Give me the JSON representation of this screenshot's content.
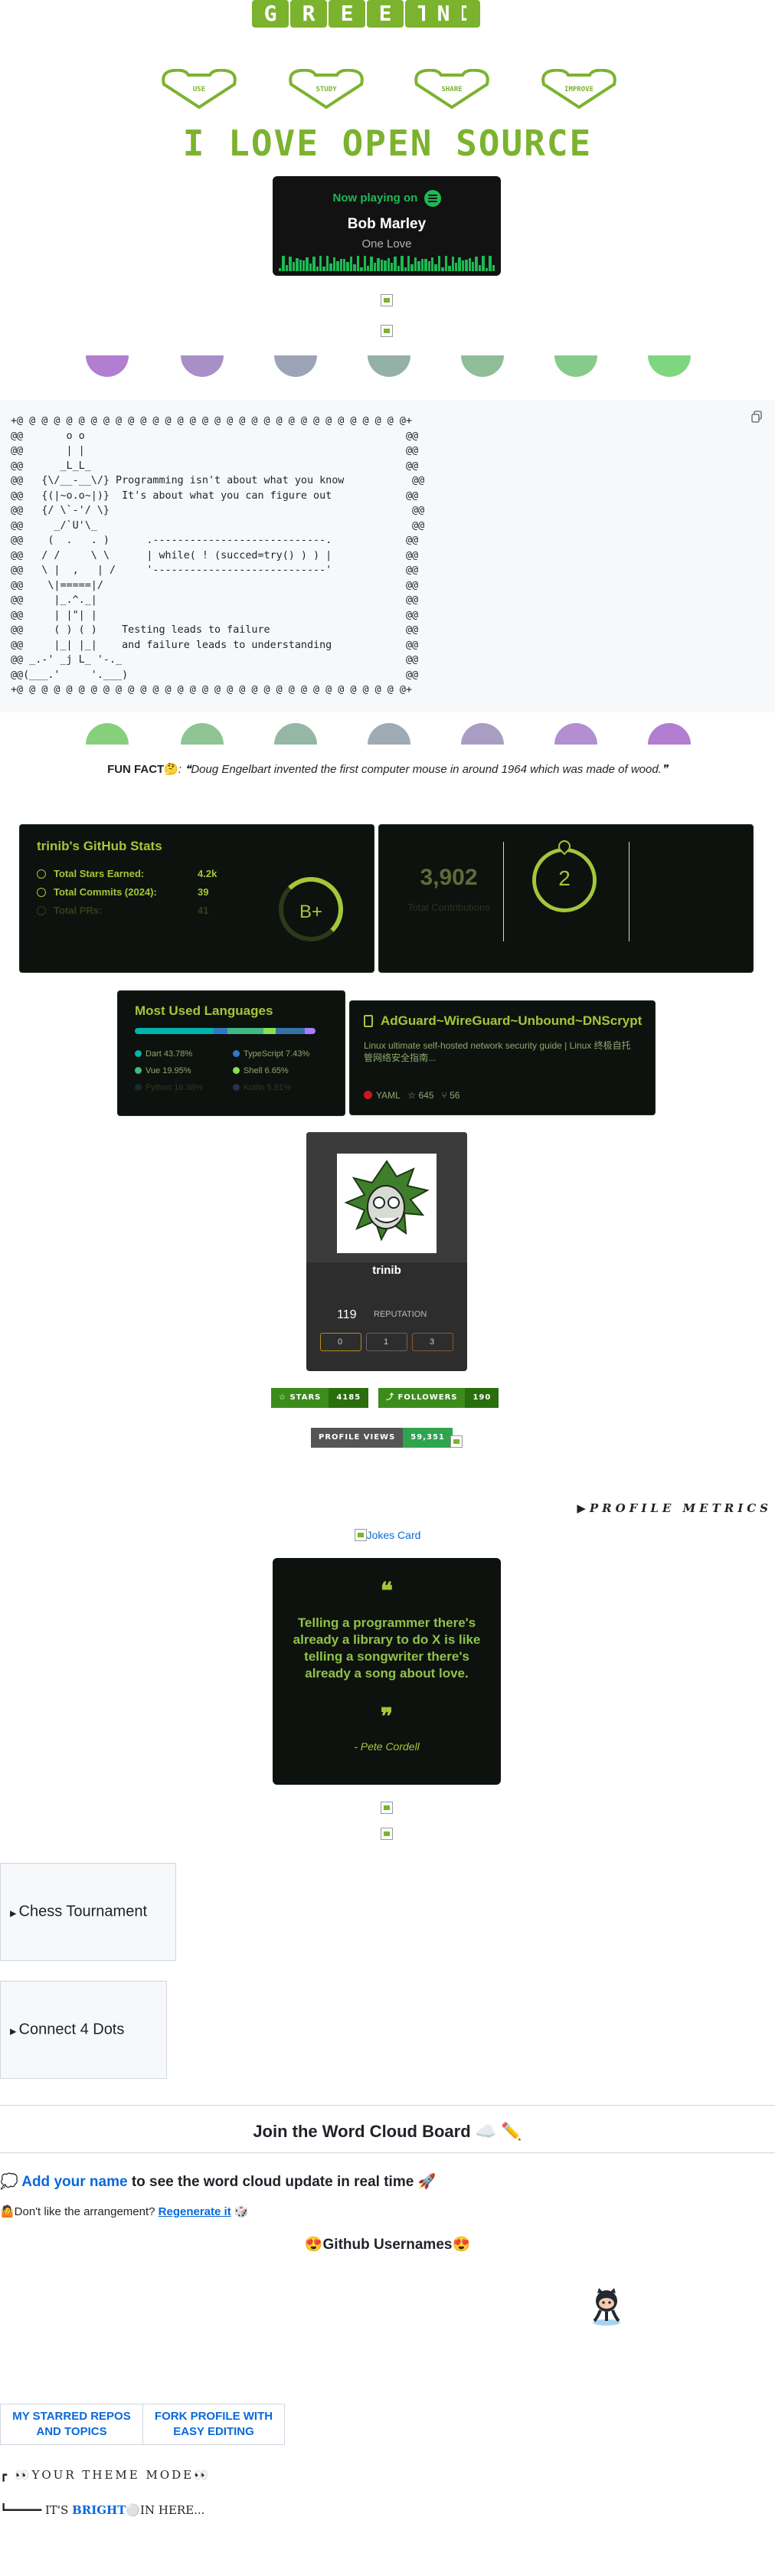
{
  "banner": {
    "letters": [
      "G",
      "R",
      "E",
      "E",
      "T",
      "I",
      "N"
    ],
    "hearts": [
      "USE",
      "STUDY",
      "SHARE",
      "IMPROVE"
    ],
    "title": "I LOVE OPEN SOURCE"
  },
  "spotify": {
    "now_playing": "Now playing on",
    "artist": "Bob Marley",
    "song": "One Love",
    "accent": "#1db954"
  },
  "drops_top": [
    "#b27ed1",
    "#a890c6",
    "#9ea4b8",
    "#94b1a8",
    "#8fbe98",
    "#86cb8b",
    "#7ed67f"
  ],
  "drops_bottom": [
    "#86d07c",
    "#8fc494",
    "#94b7a6",
    "#9eabb4",
    "#a89ec4",
    "#b18fd0",
    "#b27ed1"
  ],
  "code": {
    "ascii": "+@ @ @ @ @ @ @ @ @ @ @ @ @ @ @ @ @ @ @ @ @ @ @ @ @ @ @ @ @ @ @ @+\n@@       o o                                                    @@\n@@       | |                                                    @@\n@@      _L_L_                                                   @@\n@@   {\\/__-__\\/} Programming isn't about what you know           @@\n@@   {(|~o.o~|)}  It's about what you can figure out            @@\n@@   {/ \\`-'/ \\}                                                 @@\n@@     _/`U'\\_                                                   @@\n@@    (  .   . )      .----------------------------.            @@\n@@   / /     \\ \\      | while( ! (succed=try() ) ) |            @@\n@@   \\ |  ,   | /     '----------------------------'            @@\n@@    \\|=====|/                                                 @@\n@@     |_.^._|                                                  @@\n@@     | |\"| |                                                  @@\n@@     ( ) ( )    Testing leads to failure                      @@\n@@     |_| |_|    and failure leads to understanding            @@\n@@ _.-' _j L_ '-._                                              @@\n@@(___.'     '.___)                                             @@\n+@ @ @ @ @ @ @ @ @ @ @ @ @ @ @ @ @ @ @ @ @ @ @ @ @ @ @ @ @ @ @ @+"
  },
  "fun_fact": {
    "label": "FUN FACT",
    "emoji": "🤔",
    "text": ": ❝Doug Engelbart invented the first computer mouse in around 1964 which was made of wood.❞"
  },
  "github_stats": {
    "title": "trinib's GitHub Stats",
    "rows": [
      {
        "label": "Total Stars Earned:",
        "value": "4.2k"
      },
      {
        "label": "Total Commits (2024):",
        "value": "39"
      },
      {
        "label": "Total PRs:",
        "value": "41"
      }
    ],
    "grade": "B+",
    "accent": "#a4c639"
  },
  "streak": {
    "total": "3,902",
    "total_label": "Total Contributions",
    "current": "2"
  },
  "languages": {
    "title": "Most Used Languages",
    "items": [
      {
        "name": "Dart 43.78%",
        "color": "#00b4ab",
        "pct": 43.78
      },
      {
        "name": "TypeScript 7.43%",
        "color": "#3178c6",
        "pct": 7.43
      },
      {
        "name": "Vue 19.95%",
        "color": "#41b883",
        "pct": 19.95
      },
      {
        "name": "Shell 6.65%",
        "color": "#89e051",
        "pct": 6.65
      },
      {
        "name": "Python 16.38%",
        "color": "#3572a5",
        "pct": 16.38
      },
      {
        "name": "Kotlin 5.81%",
        "color": "#a97bff",
        "pct": 5.81
      }
    ]
  },
  "repo": {
    "title": "AdGuard~WireGuard~Unbound~DNScrypt",
    "desc": "Linux ultimate self-hosted network security guide  |  Linux 终极自托管网络安全指南...",
    "lang": "YAML",
    "lang_color": "#cb171e",
    "stars": "645",
    "forks": "56"
  },
  "stackoverflow": {
    "name": "trinib",
    "reputation": "119",
    "reputation_label": "REPUTATION",
    "badges": [
      "0",
      "1",
      "3"
    ]
  },
  "shields": {
    "stars_label": "STARS",
    "stars_value": "4185",
    "followers_label": "FOLLOWERS",
    "followers_value": "190",
    "views_label": "PROFILE VIEWS",
    "views_value": "59,351"
  },
  "metrics": "PROFILE METRICS",
  "jokes_alt": "Jokes Card",
  "quote": {
    "text": "Telling a programmer there's already a library to do X is like telling a songwriter there's already a song about love.",
    "author": "- Pete Cordell",
    "open": "❝",
    "close": "❞"
  },
  "games": [
    "Chess Tournament",
    "Connect 4 Dots"
  ],
  "word_cloud": {
    "title": "Join the Word Cloud Board ☁️ ✏️",
    "add_prefix": "💭 ",
    "add_link": "Add your name",
    "add_suffix": " to see the word cloud update in real time 🚀",
    "regen_prefix": "🤷Don't like the arrangement? ",
    "regen_link": "Regenerate it",
    "regen_suffix": " 🎲",
    "usernames": "😍Github Usernames😍"
  },
  "buttons": {
    "starred": "MY STARRED REPOS AND TOPICS",
    "fork": "FORK PROFILE WITH EASY EDITING"
  },
  "theme": {
    "line1": "┏ 👀YOUR THEME MODE👀",
    "line2_prefix": "┗━━━━━ IT'S ",
    "line2_bright": "BRIGHT",
    "line2_suffix": "⚪IN HERE..."
  }
}
